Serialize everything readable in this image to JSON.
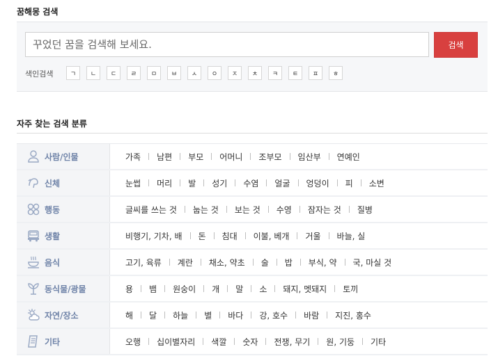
{
  "search": {
    "title": "꿈해몽 검색",
    "placeholder": "꾸었던 꿈을 검색해 보세요.",
    "button_label": "검색",
    "index_label": "색인검색",
    "index_letters": [
      "ㄱ",
      "ㄴ",
      "ㄷ",
      "ㄹ",
      "ㅁ",
      "ㅂ",
      "ㅅ",
      "ㅇ",
      "ㅈ",
      "ㅊ",
      "ㅋ",
      "ㅌ",
      "ㅍ",
      "ㅎ"
    ]
  },
  "categories_title": "자주 찾는 검색 분류",
  "categories": [
    {
      "icon": "person-icon",
      "name": "사람/인물",
      "items": [
        "가족",
        "남편",
        "부모",
        "어머니",
        "조부모",
        "임산부",
        "연예인"
      ]
    },
    {
      "icon": "body-icon",
      "name": "신체",
      "items": [
        "눈썹",
        "머리",
        "발",
        "성기",
        "수염",
        "얼굴",
        "엉덩이",
        "피",
        "소변"
      ]
    },
    {
      "icon": "activity-icon",
      "name": "행동",
      "items": [
        "글씨를 쓰는 것",
        "눕는 것",
        "보는 것",
        "수영",
        "잠자는 것",
        "질병"
      ]
    },
    {
      "icon": "car-icon",
      "name": "생활",
      "items": [
        "비행기, 기차, 배",
        "돈",
        "침대",
        "이불, 베개",
        "거울",
        "바늘, 실"
      ]
    },
    {
      "icon": "food-icon",
      "name": "음식",
      "items": [
        "고기, 육류",
        "계란",
        "채소, 약초",
        "술",
        "밥",
        "부식, 약",
        "국, 마실 것"
      ]
    },
    {
      "icon": "plant-icon",
      "name": "동식물/광물",
      "items": [
        "용",
        "뱀",
        "원숭이",
        "개",
        "말",
        "소",
        "돼지, 멧돼지",
        "토끼"
      ]
    },
    {
      "icon": "weather-icon",
      "name": "자연/장소",
      "items": [
        "해",
        "달",
        "하늘",
        "별",
        "바다",
        "강, 호수",
        "바람",
        "지진, 홍수"
      ]
    },
    {
      "icon": "document-icon",
      "name": "기타",
      "items": [
        "오행",
        "십이별자리",
        "색깔",
        "숫자",
        "전쟁, 무기",
        "원, 기둥",
        "기타"
      ]
    }
  ],
  "colors": {
    "accent": "#d8403f",
    "category_text": "#6f83a8",
    "icon": "#9aa9c4"
  }
}
